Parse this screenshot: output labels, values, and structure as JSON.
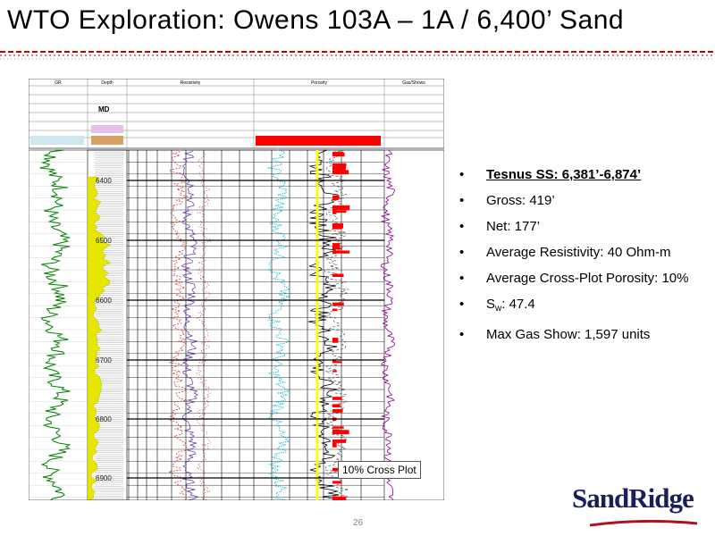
{
  "slide": {
    "title": "WTO Exploration: Owens 103A – 1A / 6,400’ Sand",
    "page_number": "26",
    "logo_text": "SandRidge"
  },
  "log": {
    "header_columns": [
      "GR",
      "Depth",
      "Resistivity",
      "Porosity",
      "Gas/Shows"
    ],
    "md_label": "MD",
    "depths": [
      "6400",
      "6500",
      "6600",
      "6700",
      "6800",
      "6900"
    ],
    "callout": "10% Cross Plot"
  },
  "bullets": {
    "head": "Tesnus SS: 6,381’-6,874’",
    "gross": "Gross: 419’",
    "net": "Net: 177’",
    "resistivity": "Average Resistivity: 40 Ohm-m",
    "porosity": "Average Cross-Plot Porosity: 10%",
    "sw_prefix": "S",
    "sw_sub": "w",
    "sw_value": ": 47.4",
    "gas": "Max Gas Show: 1,597 units",
    "bullet_char": "•"
  },
  "colors": {
    "accent_red": "#c00000",
    "logo_navy": "#1a1f5c",
    "gr_green": "#008000",
    "sand_yellow": "#e6e600",
    "porosity_cyan": "#00bcd4"
  }
}
